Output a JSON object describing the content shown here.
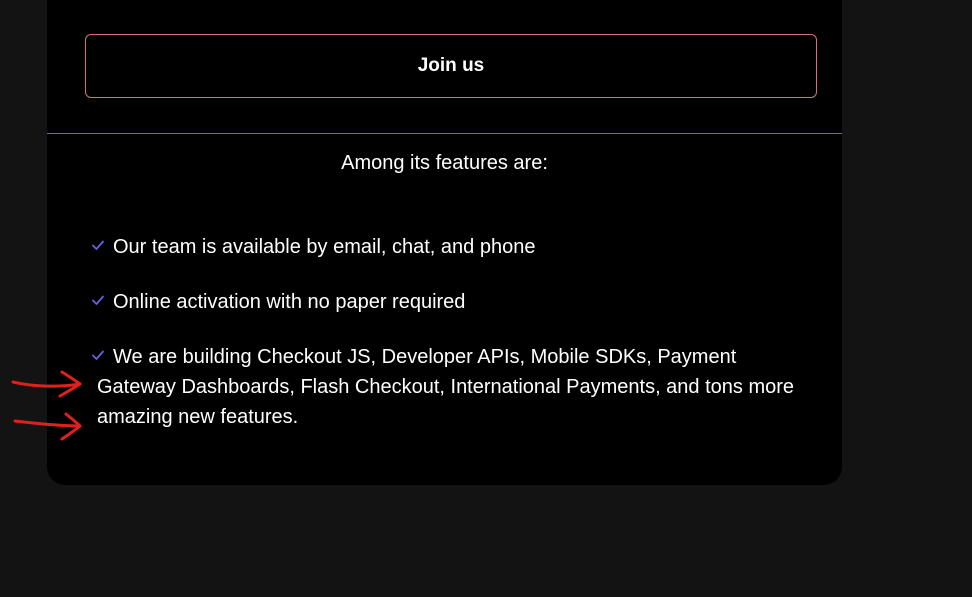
{
  "card": {
    "join_button_label": "Join us",
    "features_heading": "Among its features are:",
    "features": [
      {
        "icon": "check-icon",
        "text": "Our team is available by email, chat, and phone"
      },
      {
        "icon": "check-icon",
        "text": "Online activation with no paper required"
      },
      {
        "icon": "check-icon",
        "text": "We are building Checkout JS, Developer APIs, Mobile SDKs, Payment Gateway Dashboards, Flash Checkout, International Payments, and tons more amazing new features."
      }
    ]
  },
  "colors": {
    "page_background": "#131313",
    "card_background": "#000000",
    "button_border": "#d9707c",
    "divider": "#6a5ee0",
    "check": "#6a5ee0",
    "annotation_arrow": "#e0201c",
    "text": "#ffffff"
  },
  "annotations": [
    {
      "type": "hand-drawn-arrow",
      "icon": "arrow-right-icon"
    },
    {
      "type": "hand-drawn-arrow",
      "icon": "arrow-right-icon"
    }
  ]
}
